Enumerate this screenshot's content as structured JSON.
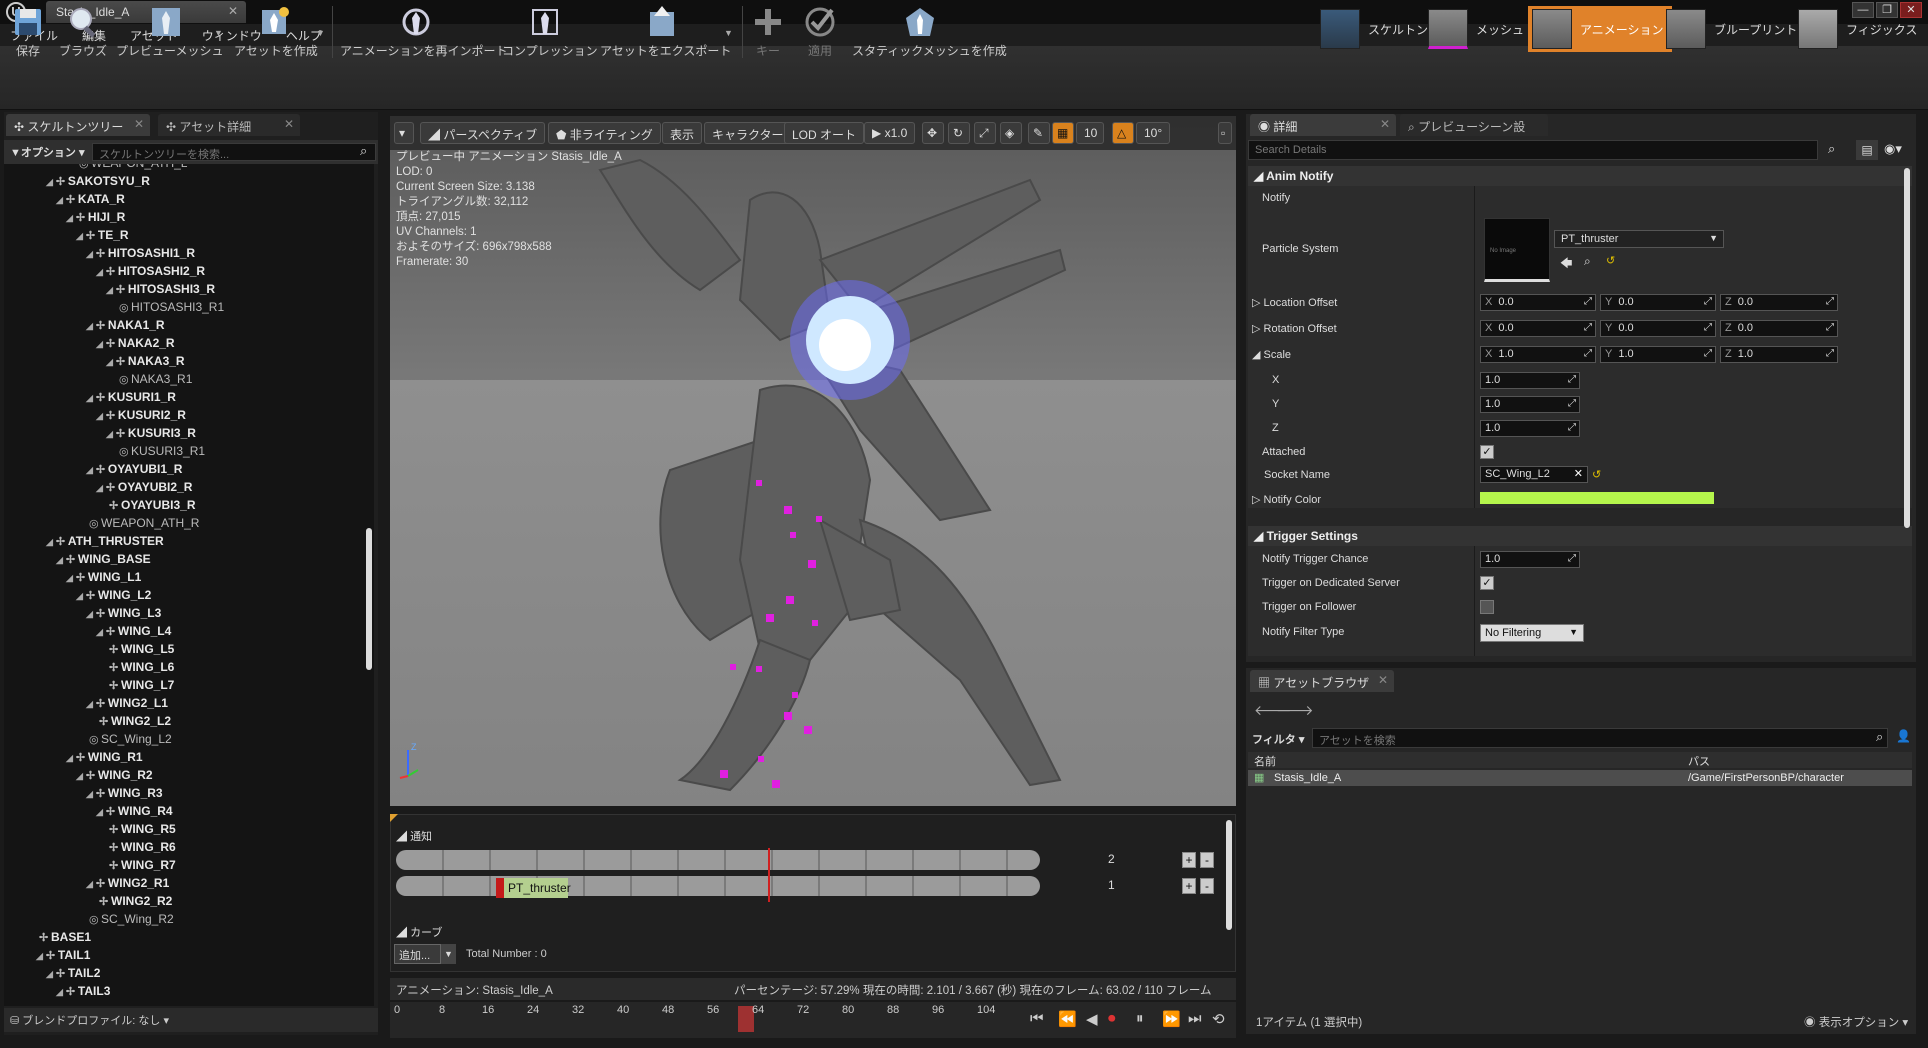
{
  "window": {
    "tab_title": "Stasis_Idle_A",
    "minimize": "—",
    "restore": "❐",
    "close": "✕"
  },
  "menu": [
    "ファイル",
    "編集",
    "アセット",
    "ウィンドウ",
    "ヘルプ"
  ],
  "toolbar": {
    "save": "保存",
    "browse": "ブラウズ",
    "preview_mesh": "プレビューメッシュ",
    "create_asset": "アセットを作成",
    "reimport": "アニメーションを再インポート",
    "compression": "コンプレッション",
    "export": "アセットをエクスポート",
    "key": "キー",
    "apply": "適用",
    "make_static": "スタティックメッシュを作成"
  },
  "modes": {
    "skeleton": "スケルトン",
    "mesh": "メッシュ",
    "animation": "アニメーション",
    "blueprint": "ブループリント",
    "physics": "フィジックス",
    "active": "animation"
  },
  "tree": {
    "tabs": [
      "スケルトンツリー",
      "アセット詳細"
    ],
    "options": "オプション",
    "search_placeholder": "スケルトンツリーを検索...",
    "blend_profile": "ブレンドプロファイル: なし",
    "nodes": [
      {
        "label": "WEAPON_ATH_L",
        "d": 7,
        "arrow": false,
        "soc": true
      },
      {
        "label": "SAKOTSYU_R",
        "d": 4,
        "arrow": true
      },
      {
        "label": "KATA_R",
        "d": 5,
        "arrow": true
      },
      {
        "label": "HIJI_R",
        "d": 6,
        "arrow": true
      },
      {
        "label": "TE_R",
        "d": 7,
        "arrow": true
      },
      {
        "label": "HITOSASHI1_R",
        "d": 8,
        "arrow": true
      },
      {
        "label": "HITOSASHI2_R",
        "d": 9,
        "arrow": true
      },
      {
        "label": "HITOSASHI3_R",
        "d": 10,
        "arrow": true
      },
      {
        "label": "HITOSASHI3_R1",
        "d": 11,
        "arrow": false,
        "soc": true
      },
      {
        "label": "NAKA1_R",
        "d": 8,
        "arrow": true
      },
      {
        "label": "NAKA2_R",
        "d": 9,
        "arrow": true
      },
      {
        "label": "NAKA3_R",
        "d": 10,
        "arrow": true
      },
      {
        "label": "NAKA3_R1",
        "d": 11,
        "arrow": false,
        "soc": true
      },
      {
        "label": "KUSURI1_R",
        "d": 8,
        "arrow": true
      },
      {
        "label": "KUSURI2_R",
        "d": 9,
        "arrow": true
      },
      {
        "label": "KUSURI3_R",
        "d": 10,
        "arrow": true
      },
      {
        "label": "KUSURI3_R1",
        "d": 11,
        "arrow": false,
        "soc": true
      },
      {
        "label": "OYAYUBI1_R",
        "d": 8,
        "arrow": true
      },
      {
        "label": "OYAYUBI2_R",
        "d": 9,
        "arrow": true
      },
      {
        "label": "OYAYUBI3_R",
        "d": 10,
        "arrow": false
      },
      {
        "label": "WEAPON_ATH_R",
        "d": 8,
        "arrow": false,
        "soc": true
      },
      {
        "label": "ATH_THRUSTER",
        "d": 4,
        "arrow": true
      },
      {
        "label": "WING_BASE",
        "d": 5,
        "arrow": true
      },
      {
        "label": "WING_L1",
        "d": 6,
        "arrow": true
      },
      {
        "label": "WING_L2",
        "d": 7,
        "arrow": true
      },
      {
        "label": "WING_L3",
        "d": 8,
        "arrow": true
      },
      {
        "label": "WING_L4",
        "d": 9,
        "arrow": true
      },
      {
        "label": "WING_L5",
        "d": 10,
        "arrow": false
      },
      {
        "label": "WING_L6",
        "d": 10,
        "arrow": false
      },
      {
        "label": "WING_L7",
        "d": 10,
        "arrow": false
      },
      {
        "label": "WING2_L1",
        "d": 8,
        "arrow": true
      },
      {
        "label": "WING2_L2",
        "d": 9,
        "arrow": false
      },
      {
        "label": "SC_Wing_L2",
        "d": 8,
        "arrow": false,
        "soc": true
      },
      {
        "label": "WING_R1",
        "d": 6,
        "arrow": true
      },
      {
        "label": "WING_R2",
        "d": 7,
        "arrow": true
      },
      {
        "label": "WING_R3",
        "d": 8,
        "arrow": true
      },
      {
        "label": "WING_R4",
        "d": 9,
        "arrow": true
      },
      {
        "label": "WING_R5",
        "d": 10,
        "arrow": false
      },
      {
        "label": "WING_R6",
        "d": 10,
        "arrow": false
      },
      {
        "label": "WING_R7",
        "d": 10,
        "arrow": false
      },
      {
        "label": "WING2_R1",
        "d": 8,
        "arrow": true
      },
      {
        "label": "WING2_R2",
        "d": 9,
        "arrow": false
      },
      {
        "label": "SC_Wing_R2",
        "d": 8,
        "arrow": false,
        "soc": true
      },
      {
        "label": "BASE1",
        "d": 3,
        "arrow": false
      },
      {
        "label": "TAIL1",
        "d": 3,
        "arrow": true
      },
      {
        "label": "TAIL2",
        "d": 4,
        "arrow": true
      },
      {
        "label": "TAIL3",
        "d": 5,
        "arrow": true
      }
    ]
  },
  "viewport": {
    "perspective": "パースペクティブ",
    "lighting": "非ライティング",
    "show": "表示",
    "character": "キャラクター",
    "lod": "LOD オート",
    "speed": "x1.0",
    "grid": "10",
    "angle": "10°",
    "info": [
      "プレビュー中 アニメーション Stasis_Idle_A",
      "LOD: 0",
      "Current Screen Size: 3.138",
      "トライアングル数: 32,112",
      "頂点: 27,015",
      "UV Channels: 1",
      "およそのサイズ: 696x798x588",
      "Framerate: 30"
    ]
  },
  "timeline": {
    "notify_section": "通知",
    "track1_count": "2",
    "track2_count": "1",
    "notify_name": "PT_thruster",
    "curve_section": "カーブ",
    "add": "追加...",
    "total": "Total Number : 0",
    "anim_label": "アニメーション: Stasis_Idle_A",
    "status": "パーセンテージ: 57.29% 現在の時間: 2.101 / 3.667 (秒) 現在のフレーム: 63.02 / 110 フレーム",
    "ticks": [
      "0",
      "8",
      "16",
      "24",
      "32",
      "40",
      "48",
      "56",
      "64",
      "72",
      "80",
      "88",
      "96",
      "104"
    ]
  },
  "details": {
    "tabs": [
      "詳細",
      "プレビューシーン設"
    ],
    "search_placeholder": "Search Details",
    "anim_notify": "Anim Notify",
    "notify": "Notify",
    "particle_system": "Particle System",
    "ps_value": "PT_thruster",
    "no_image": "No Image",
    "location_offset": "Location Offset",
    "rotation_offset": "Rotation Offset",
    "scale": "Scale",
    "x": "X",
    "y": "Y",
    "z": "Z",
    "zero": "0.0",
    "one": "1.0",
    "attached": "Attached",
    "socket_name": "Socket Name",
    "socket_value": "SC_Wing_L2",
    "notify_color": "Notify Color",
    "trigger_settings": "Trigger Settings",
    "trigger_chance": "Notify Trigger Chance",
    "chance_value": "1.0",
    "dedicated": "Trigger on Dedicated Server",
    "follower": "Trigger on Follower",
    "filter_type": "Notify Filter Type",
    "filter_value": "No Filtering"
  },
  "asset_browser": {
    "tab": "アセットブラウザ",
    "filter": "フィルタ",
    "search_placeholder": "アセットを検索",
    "col_name": "名前",
    "col_path": "パス",
    "row_name": "Stasis_Idle_A",
    "row_path": "/Game/FirstPersonBP/character",
    "footer": "1アイテム (1 選択中)",
    "view_options": "表示オプション"
  },
  "colors": {
    "accent": "#e0822a",
    "notify_color": "#b5f54c",
    "notify_block": "#b4cf8f"
  }
}
